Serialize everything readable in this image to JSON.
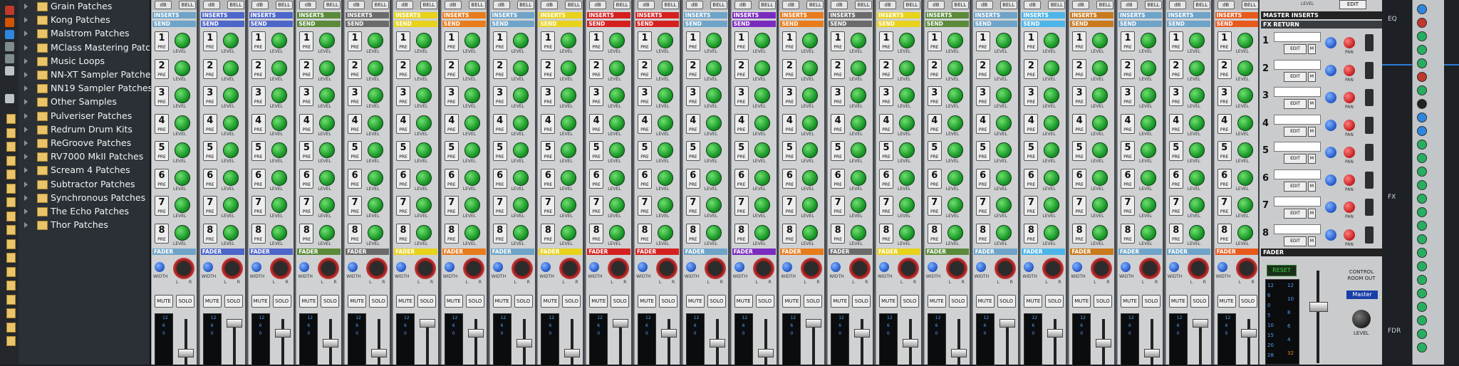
{
  "browser": {
    "items": [
      {
        "label": "Grain Patches"
      },
      {
        "label": "Kong Patches"
      },
      {
        "label": "Malstrom Patches"
      },
      {
        "label": "MClass Mastering Patche"
      },
      {
        "label": "Music Loops"
      },
      {
        "label": "NN-XT Sampler Patches"
      },
      {
        "label": "NN19 Sampler Patches"
      },
      {
        "label": "Other Samples"
      },
      {
        "label": "Pulveriser Patches"
      },
      {
        "label": "Redrum Drum Kits"
      },
      {
        "label": "ReGroove Patches"
      },
      {
        "label": "RV7000 MkII Patches"
      },
      {
        "label": "Scream 4 Patches"
      },
      {
        "label": "Subtractor Patches"
      },
      {
        "label": "Synchronous Patches"
      },
      {
        "label": "The Echo Patches"
      },
      {
        "label": "Thor Patches"
      }
    ]
  },
  "mixer": {
    "strip_labels": {
      "db": "dB",
      "bell": "BELL",
      "inserts": "INSERTS",
      "send": "SEND",
      "pre": "PRE",
      "level": "LEVEL",
      "fader": "FADER",
      "width": "WIDTH",
      "l": "L",
      "r": "R",
      "mute": "MUTE",
      "solo": "SOLO"
    },
    "send_numbers": [
      "1",
      "2",
      "3",
      "4",
      "5",
      "6",
      "7",
      "8"
    ],
    "meter_ticks": [
      "12",
      "6",
      "0"
    ],
    "strip_colors": [
      "#6fa4c8",
      "#4d66c9",
      "#4d66c9",
      "#5a8a3a",
      "#6b6b6b",
      "#e8d21c",
      "#e87c1c",
      "#6fa4c8",
      "#e8d21c",
      "#d62020",
      "#d62020",
      "#6fa4c8",
      "#7a2bbf",
      "#e87c1c",
      "#6b6b6b",
      "#e8d21c",
      "#5a8a3a",
      "#6fa4c8",
      "#4db5e8",
      "#c97a1c",
      "#6fa4c8",
      "#6fa4c8",
      "#e85a1c"
    ]
  },
  "master": {
    "master_inserts": "MASTER INSERTS",
    "fx_return": "FX RETURN",
    "fx_edit": "EDIT",
    "fx_m": "M",
    "fx_pan": "PAN",
    "fader": "FADER",
    "reset": "RESET",
    "control_room_out": "CONTROL ROOM OUT",
    "master_label": "Master",
    "level": "LEVEL",
    "edit": "EDIT",
    "meter_scale": [
      "12",
      "6",
      "0",
      "5",
      "10",
      "15",
      "20",
      "28"
    ],
    "meter_scale_right": [
      "12",
      "10",
      "8",
      "6",
      "4",
      "32"
    ]
  },
  "right_panel": {
    "eq": "EQ",
    "fx": "FX",
    "fdr": "FDR"
  }
}
